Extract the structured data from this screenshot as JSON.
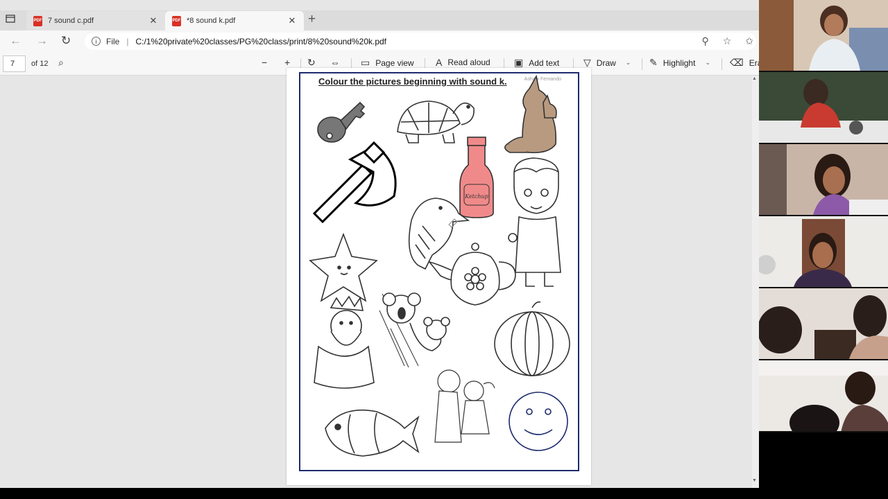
{
  "tabs": [
    {
      "label": "7 sound c.pdf",
      "active": false
    },
    {
      "label": "*8 sound k.pdf",
      "active": true
    }
  ],
  "address": {
    "info_icon": "info-icon",
    "scheme_label": "File",
    "url": "C:/1%20private%20classes/PG%20class/print/8%20sound%20k.pdf"
  },
  "pdf_toolbar": {
    "page_number": "7",
    "page_count": "of 12",
    "page_view_label": "Page view",
    "read_aloud_label": "Read aloud",
    "add_text_label": "Add text",
    "draw_label": "Draw",
    "highlight_label": "Highlight",
    "erase_label": "Eras"
  },
  "worksheet": {
    "title": "Colour the pictures beginning with sound k.",
    "author": "Ashani Fernando",
    "bottle_label": "Ketchup",
    "pictures": [
      "key",
      "turtle",
      "kangaroo",
      "axe",
      "ketchup-bottle",
      "kingfisher",
      "doctor",
      "starfish",
      "kettle",
      "koala",
      "king",
      "pumpkin",
      "kiss",
      "fish",
      "smiley-face"
    ]
  },
  "colors": {
    "frame": "#1c2a6e",
    "ketchup_fill": "#f08a8a",
    "kangaroo_fill": "#b89a80",
    "key_fill": "#777777"
  },
  "participants": [
    "student-girl-1",
    "student-boy-1",
    "student-girl-2",
    "teacher",
    "students-group-1",
    "students-group-2"
  ]
}
